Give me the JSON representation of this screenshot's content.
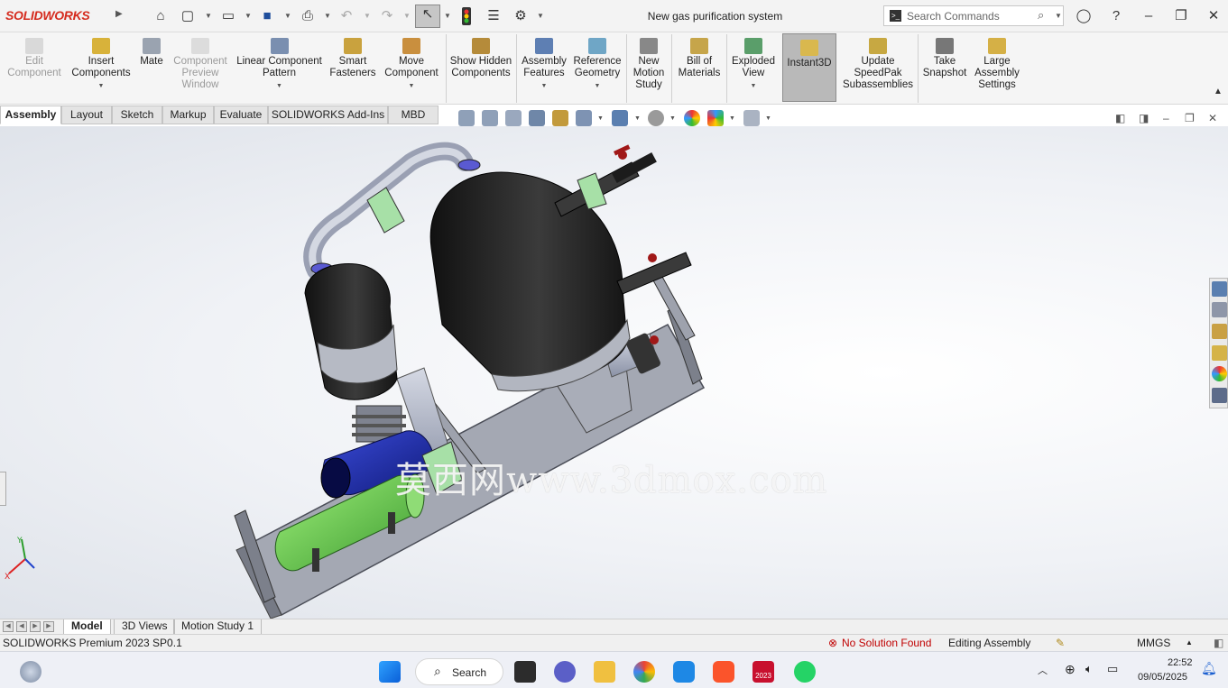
{
  "app": {
    "brand": "SOLIDWORKS",
    "document_title": "New gas purification system"
  },
  "search": {
    "placeholder": "Search Commands"
  },
  "ribbon": [
    {
      "id": "edit-component",
      "label": "Edit Component",
      "disabled": true,
      "icon": "edit-component-icon"
    },
    {
      "id": "insert-components",
      "label": "Insert Components",
      "icon": "insert-components-icon",
      "dropdown": true
    },
    {
      "id": "mate",
      "label": "Mate",
      "icon": "mate-icon"
    },
    {
      "id": "component-preview-window",
      "label": "Component Preview Window",
      "disabled": true,
      "icon": "component-preview-icon"
    },
    {
      "id": "linear-component-pattern",
      "label": "Linear Component Pattern",
      "icon": "linear-pattern-icon",
      "dropdown": true
    },
    {
      "id": "smart-fasteners",
      "label": "Smart Fasteners",
      "icon": "smart-fasteners-icon"
    },
    {
      "id": "move-component",
      "label": "Move Component",
      "icon": "move-component-icon",
      "dropdown": true
    },
    {
      "id": "show-hidden-components",
      "label": "Show Hidden Components",
      "icon": "show-hidden-icon"
    },
    {
      "id": "assembly-features",
      "label": "Assembly Features",
      "icon": "assembly-features-icon",
      "dropdown": true
    },
    {
      "id": "reference-geometry",
      "label": "Reference Geometry",
      "icon": "reference-geometry-icon",
      "dropdown": true
    },
    {
      "id": "new-motion-study",
      "label": "New Motion Study",
      "icon": "motion-study-icon"
    },
    {
      "id": "bill-of-materials",
      "label": "Bill of Materials",
      "icon": "bill-of-materials-icon"
    },
    {
      "id": "exploded-view",
      "label": "Exploded View",
      "icon": "exploded-view-icon",
      "dropdown": true
    },
    {
      "id": "instant3d",
      "label": "Instant3D",
      "icon": "instant3d-icon",
      "active": true
    },
    {
      "id": "update-speedpak",
      "label": "Update SpeedPak Subassemblies",
      "icon": "speedpak-icon"
    },
    {
      "id": "take-snapshot",
      "label": "Take Snapshot",
      "icon": "camera-icon"
    },
    {
      "id": "large-assembly-settings",
      "label": "Large Assembly Settings",
      "icon": "large-assembly-icon"
    }
  ],
  "tabs": [
    "Assembly",
    "Layout",
    "Sketch",
    "Markup",
    "Evaluate",
    "SOLIDWORKS Add-Ins",
    "MBD"
  ],
  "active_tab": "Assembly",
  "watermark": "莫西网www.3dmox.com",
  "triad": {
    "x_label": "X",
    "y_label": "Y"
  },
  "bottom_tabs": [
    "Model",
    "3D Views",
    "Motion Study 1"
  ],
  "active_bottom_tab": "Model",
  "status": {
    "version": "SOLIDWORKS Premium 2023 SP0.1",
    "solution": "No Solution Found",
    "mode": "Editing Assembly",
    "units": "MMGS"
  },
  "taskbar": {
    "search_label": "Search",
    "time": "22:52",
    "date": "09/05/2025",
    "sw_badge": "2023"
  },
  "colors": {
    "accent": "#d52b1e",
    "status_error": "#c00000",
    "instant3d_bg": "#b9b9b9",
    "viewport_bg": "#eef1f5"
  }
}
